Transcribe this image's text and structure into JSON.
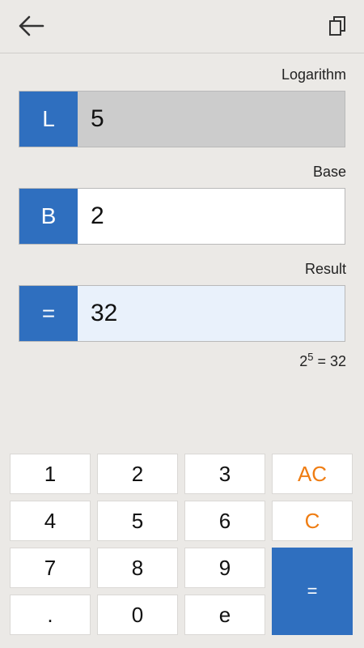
{
  "header": {
    "back_icon": "arrow-left-icon",
    "copy_icon": "copy-icon"
  },
  "fields": {
    "logarithm": {
      "label": "Logarithm",
      "tag": "L",
      "value": "5",
      "bg": "#cccccc"
    },
    "base": {
      "label": "Base",
      "tag": "B",
      "value": "2",
      "bg": "#ffffff"
    },
    "result": {
      "label": "Result",
      "tag": "=",
      "value": "32",
      "bg": "#e9f1fb"
    }
  },
  "formula": {
    "base": "2",
    "exponent": "5",
    "rest": " = 32"
  },
  "keypad": {
    "k1": "1",
    "k2": "2",
    "k3": "3",
    "ac": "AC",
    "k4": "4",
    "k5": "5",
    "k6": "6",
    "c": "C",
    "k7": "7",
    "k8": "8",
    "k9": "9",
    "equals": "=",
    "dot": ".",
    "k0": "0",
    "e": "e"
  },
  "colors": {
    "accent": "#2f6fbf",
    "orange": "#ef7d13",
    "background": "#ebe9e6"
  }
}
